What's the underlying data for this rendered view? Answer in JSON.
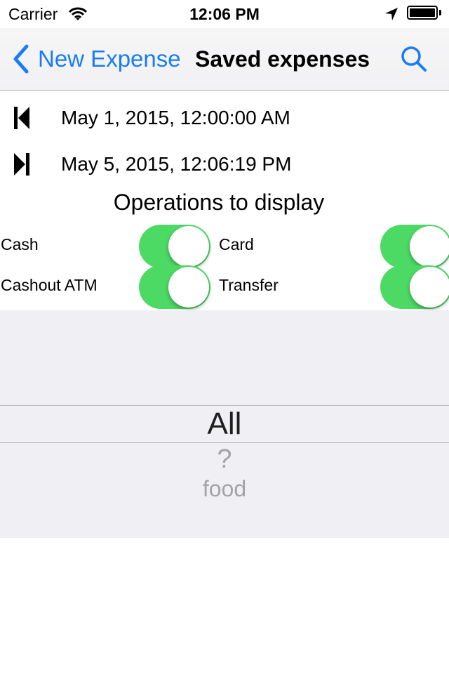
{
  "status_bar": {
    "carrier": "Carrier",
    "time": "12:06 PM"
  },
  "nav": {
    "back_label": "New Expense",
    "title": "Saved expenses",
    "accent_color": "#1a7cf5"
  },
  "date_range": {
    "start": "May 1, 2015, 12:00:00 AM",
    "end": "May 5, 2015, 12:06:19 PM"
  },
  "operations": {
    "title": "Operations to display",
    "items": [
      {
        "label": "Cash",
        "on": true
      },
      {
        "label": "Card",
        "on": true
      },
      {
        "label": "Cashout ATM",
        "on": true
      },
      {
        "label": "Transfer",
        "on": true
      }
    ],
    "toggle_color": "#4cd964"
  },
  "picker": {
    "selected": "All",
    "options_below": [
      "?",
      "food"
    ]
  }
}
